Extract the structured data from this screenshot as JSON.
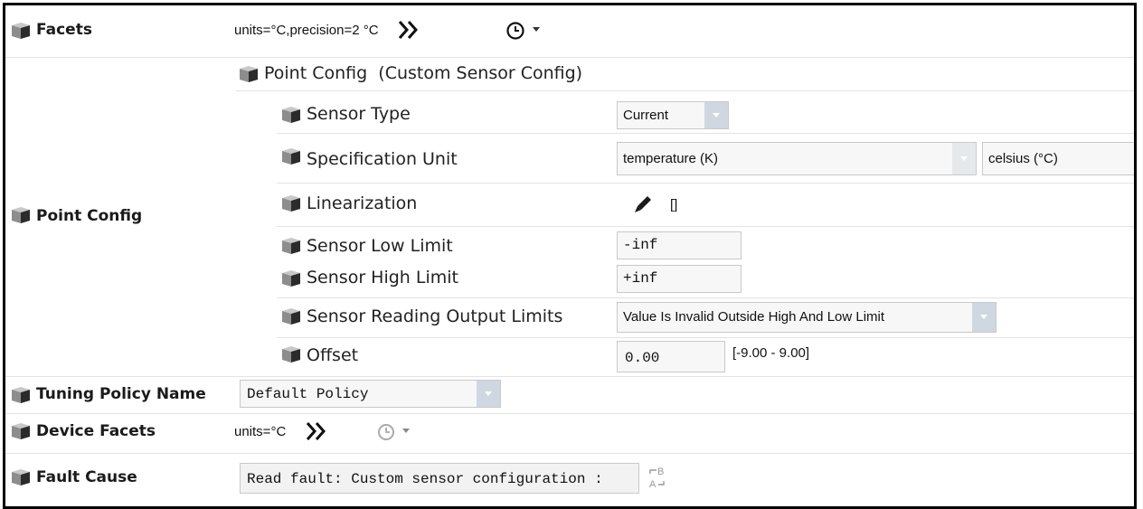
{
  "rows": {
    "facets": {
      "label": "Facets",
      "value": "units=°C,precision=2 °C"
    },
    "point_config": {
      "label": "Point Config",
      "header": "Point Config",
      "header_type": "(Custom Sensor Config)",
      "sensor_type": {
        "label": "Sensor Type",
        "value": "Current"
      },
      "specification_unit": {
        "label": "Specification Unit",
        "quantity": "temperature (K)",
        "unit": "celsius (°C)"
      },
      "linearization": {
        "label": "Linearization",
        "value": "[]"
      },
      "sensor_low_limit": {
        "label": "Sensor Low Limit",
        "value": "-inf"
      },
      "sensor_high_limit": {
        "label": "Sensor High Limit",
        "value": "+inf"
      },
      "output_limits": {
        "label": "Sensor Reading Output Limits",
        "value": "Value Is Invalid Outside High And Low Limit"
      },
      "offset": {
        "label": "Offset",
        "value": "0.00",
        "range": "[-9.00 - 9.00]"
      }
    },
    "tuning_policy": {
      "label": "Tuning Policy Name",
      "value": "Default Policy"
    },
    "device_facets": {
      "label": "Device Facets",
      "value": "units=°C"
    },
    "fault_cause": {
      "label": "Fault Cause",
      "value": "Read fault: Custom sensor configuration :"
    }
  },
  "icons": {
    "property": "cube-icon",
    "edit_facets": "double-chevron-right-icon",
    "history": "clock-icon",
    "dropdown": "triangle-down-icon",
    "pencil": "pencil-icon",
    "text_convert": "text-ab-icon"
  },
  "colors": {
    "dropdown_button": "#cfd8e0",
    "field_bg": "#f7f7f7",
    "field_border": "#c9c9c9"
  }
}
